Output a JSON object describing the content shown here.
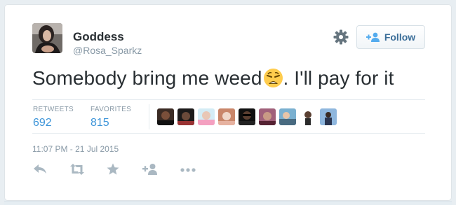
{
  "user": {
    "name": "Goddess",
    "handle": "@Rosa_Sparkz"
  },
  "follow_button": {
    "label": "Follow"
  },
  "tweet": {
    "text_before_emoji": "Somebody bring me weed",
    "emoji": "weary-face",
    "text_after_emoji": ".   I'll pay for it"
  },
  "stats": {
    "retweets_label": "RETWEETS",
    "retweets_value": "692",
    "favorites_label": "FAVORITES",
    "favorites_value": "815"
  },
  "favoriters_count_shown": 9,
  "timestamp": "11:07 PM - 21 Jul 2015",
  "actions": [
    "reply-icon",
    "retweet-icon",
    "favorite-icon",
    "follow-user-icon",
    "more-icon"
  ],
  "colors": {
    "link_blue": "#3b94d9",
    "follow_text": "#3b6e99",
    "muted": "#8899a6",
    "icon_gray": "#aab8c2",
    "text": "#292f33"
  }
}
